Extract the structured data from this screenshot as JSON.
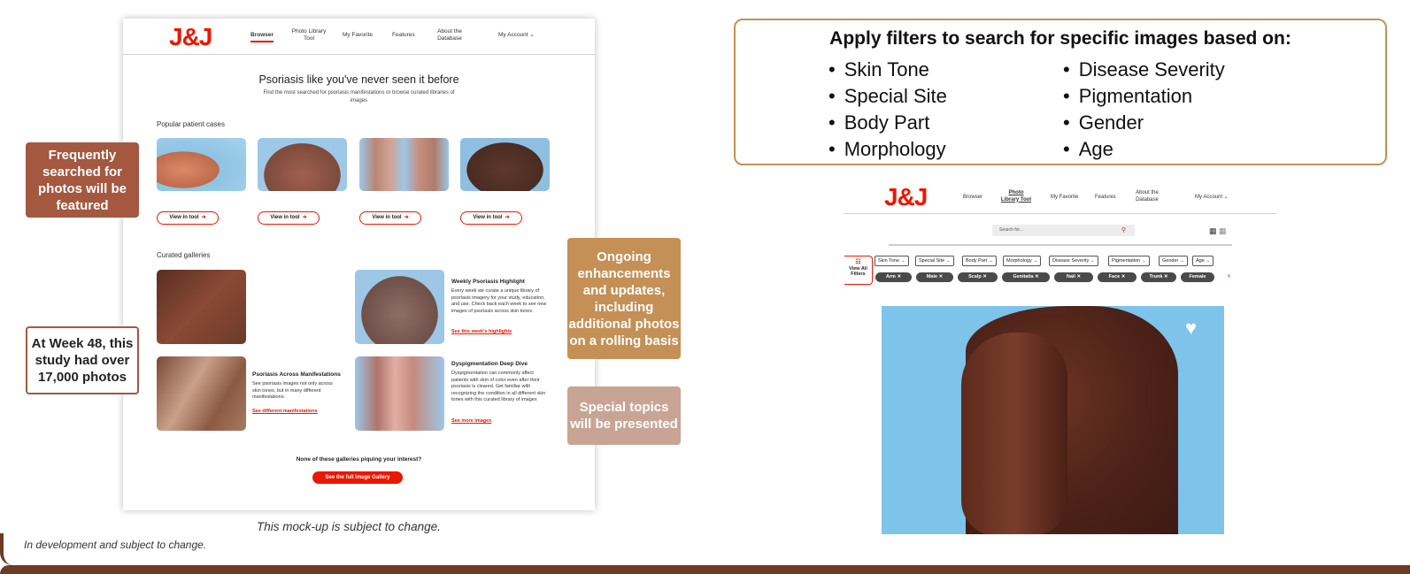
{
  "left_mockup": {
    "logo": "J&J",
    "nav": [
      {
        "label": "Browser"
      },
      {
        "label": "Photo Library Tool"
      },
      {
        "label": "My Favorite"
      },
      {
        "label": "Features"
      },
      {
        "label": "About the Database"
      },
      {
        "label": "My Account ⌄"
      }
    ],
    "hero_title": "Psoriasis like you've never seen it before",
    "hero_subtitle": "Find the most searched for psoriasis manifestations or browse curated libraries of images",
    "popular_heading": "Popular patient cases",
    "view_in_tool_label": "View in tool",
    "curated_heading": "Curated galleries",
    "cards": [
      {
        "title": "Weekly Psoriasis Highlight",
        "body": "Every week we curate a unique library of psoriasis imagery for your study, education, and use. Check back each week to see new images of psoriasis across skin tones.",
        "link": "See this week's highlights"
      },
      {
        "title": "Psoriasis Across Manifestations",
        "body": "See psoriasis images not only across skin tones, but in many different manifestations.",
        "link": "See different manifestations"
      },
      {
        "title": "Dyspigmentation Deep Dive",
        "body": "Dyspigmentation can commonly affect patients with skin of color even after their psoriasis is cleared. Get familiar with recognizing the condition in all different skin tones with this curated library of images",
        "link": "See more images"
      }
    ],
    "none_text": "None of these galleries piquing your interest?",
    "full_gallery_button": "See the full Image Gallery"
  },
  "callouts": {
    "frequent": "Frequently searched for photos will be featured",
    "week48": "At Week 48, this study had over 17,000 photos",
    "ongoing": "Ongoing enhancements and updates, including additional photos on a rolling basis",
    "special": "Special topics will be presented"
  },
  "captions": {
    "mockup": "This mock-up is subject to change.",
    "development": "In development and subject to change."
  },
  "filter_box": {
    "title": "Apply filters to search for specific images based on:",
    "left": [
      "Skin Tone",
      "Special Site",
      "Body Part",
      "Morphology"
    ],
    "right": [
      "Disease Severity",
      "Pigmentation",
      "Gender",
      "Age"
    ]
  },
  "right_mockup": {
    "logo": "J&J",
    "nav": [
      {
        "label": "Browser"
      },
      {
        "label": "Photo Library Tool"
      },
      {
        "label": "My Favorite"
      },
      {
        "label": "Features"
      },
      {
        "label": "About the Database"
      },
      {
        "label": "My Account ⌄"
      }
    ],
    "search_placeholder": "Search for...",
    "view_all_filters": "View All Filters",
    "filters": [
      "Skin Tone",
      "Special Site",
      "Body Part",
      "Morphology",
      "Disease Severity",
      "Pigmentation",
      "Gender",
      "Age"
    ],
    "tags": [
      "Arm",
      "Male",
      "Scalp",
      "Genitalia",
      "Nail",
      "Face",
      "Trunk",
      "Female"
    ]
  },
  "colors": {
    "brand_red": "#eb1700",
    "brown_accent": "#a3583f",
    "gold_accent": "#c49055",
    "rose_accent": "#c8a494"
  }
}
